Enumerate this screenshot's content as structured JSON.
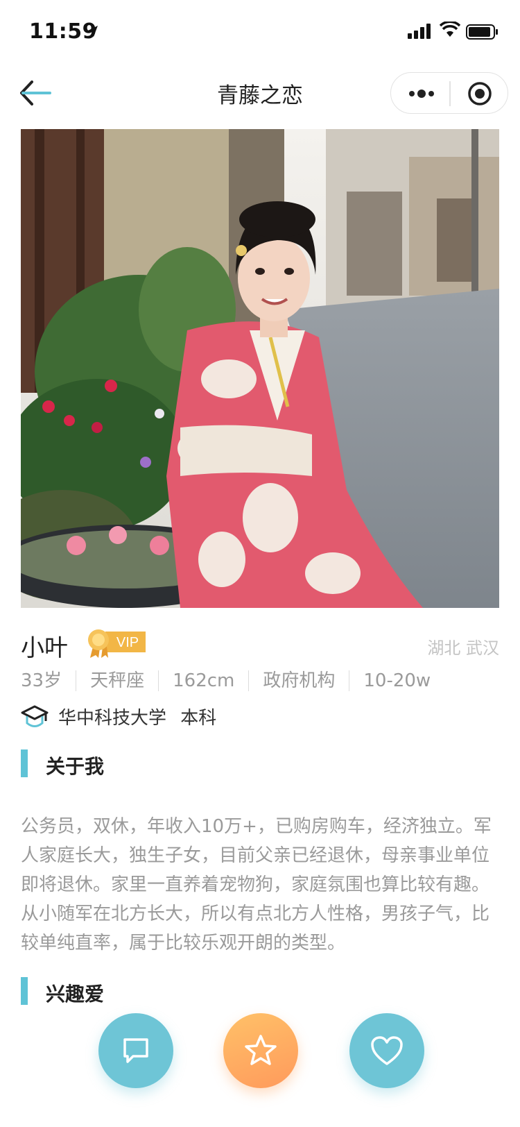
{
  "status_bar": {
    "time": "11:59",
    "icons": [
      "location-arrow-icon",
      "signal-icon",
      "wifi-icon",
      "battery-icon"
    ]
  },
  "nav": {
    "title": "青藤之恋",
    "back_icon": "back-arrow-icon",
    "capsule_icons": [
      "more-dots-icon",
      "close-target-icon"
    ]
  },
  "profile": {
    "name": "小叶",
    "badge": "VIP",
    "location": "湖北 武汉",
    "tags": [
      "33岁",
      "天秤座",
      "162cm",
      "政府机构",
      "10-20w"
    ],
    "education": {
      "school": "华中科技大学",
      "degree": "本科"
    }
  },
  "sections": {
    "about": {
      "title": "关于我",
      "text": "公务员，双休，年收入10万+，已购房购车，经济独立。军人家庭长大，独生子女，目前父亲已经退休，母亲事业单位即将退休。家里一直养着宠物狗，家庭氛围也算比较有趣。从小随军在北方长大，所以有点北方人性格，男孩子气，比较单纯直率，属于比较乐观开朗的类型。"
    },
    "hobbies": {
      "title": "兴趣爱"
    }
  },
  "actions": {
    "icons": [
      "chat-bubble-icon",
      "star-icon",
      "heart-icon"
    ]
  },
  "colors": {
    "accent": "#5fc3d6",
    "action_blue": "#6ec5d6",
    "action_orange": "#ffb062",
    "vip_gold": "#f2b646"
  }
}
